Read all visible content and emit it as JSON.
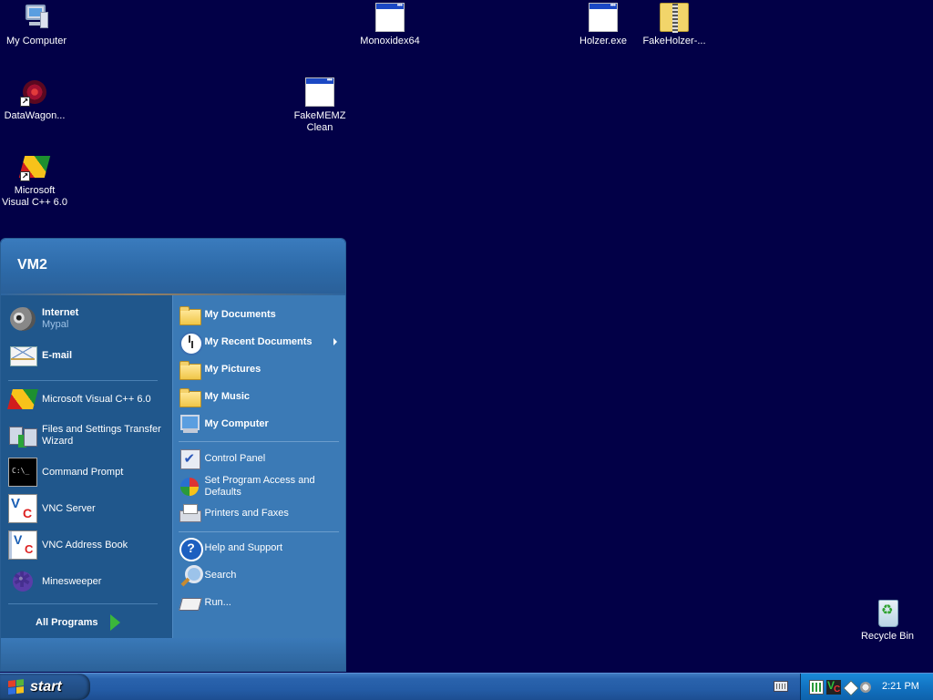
{
  "desktop": {
    "icons": [
      {
        "label": "My Computer",
        "icon": "computer-icon"
      },
      {
        "label": "Monoxidex64",
        "icon": "application-icon"
      },
      {
        "label": "Holzer.exe",
        "icon": "application-icon"
      },
      {
        "label": "FakeHolzer-...",
        "icon": "zip-folder-icon"
      },
      {
        "label": "DataWagon...",
        "icon": "web-shortcut-icon"
      },
      {
        "label": "FakeMEMZ Clean",
        "icon": "application-icon"
      },
      {
        "label": "Microsoft Visual C++ 6.0",
        "icon": "visual-cpp-icon"
      },
      {
        "label": "Recycle Bin",
        "icon": "recycle-bin-icon"
      }
    ]
  },
  "start_menu": {
    "user_name": "VM2",
    "pinned": [
      {
        "title": "Internet",
        "subtitle": "Mypal",
        "icon": "raccoon-browser-icon"
      },
      {
        "title": "E-mail",
        "icon": "mail-icon"
      }
    ],
    "recent": [
      {
        "label": "Microsoft Visual C++ 6.0",
        "icon": "visual-cpp-icon"
      },
      {
        "label": "Files and Settings Transfer Wizard",
        "icon": "transfer-wizard-icon"
      },
      {
        "label": "Command Prompt",
        "icon": "command-prompt-icon"
      },
      {
        "label": "VNC Server",
        "icon": "vnc-icon"
      },
      {
        "label": "VNC Address Book",
        "icon": "vnc-book-icon"
      },
      {
        "label": "Minesweeper",
        "icon": "minesweeper-icon"
      }
    ],
    "all_programs_label": "All Programs",
    "places": [
      {
        "label": "My Documents",
        "icon": "documents-folder-icon"
      },
      {
        "label": "My Recent Documents",
        "icon": "recent-documents-icon"
      },
      {
        "label": "My Pictures",
        "icon": "pictures-folder-icon"
      },
      {
        "label": "My Music",
        "icon": "music-folder-icon"
      },
      {
        "label": "My Computer",
        "icon": "computer-icon"
      }
    ],
    "system": [
      {
        "label": "Control Panel",
        "icon": "control-panel-icon"
      },
      {
        "label": "Set Program Access and Defaults",
        "icon": "program-defaults-icon"
      },
      {
        "label": "Printers and Faxes",
        "icon": "printer-icon"
      }
    ],
    "tools": [
      {
        "label": "Help and Support",
        "icon": "help-icon"
      },
      {
        "label": "Search",
        "icon": "search-icon"
      },
      {
        "label": "Run...",
        "icon": "run-icon"
      }
    ]
  },
  "taskbar": {
    "start_label": "start",
    "clock": "2:21 PM"
  },
  "colors": {
    "desktop_background": "#020047",
    "menu_left": "#20578c",
    "menu_right": "#3b7ab6",
    "taskbar": "#245ca6",
    "tray": "#1273c2"
  }
}
